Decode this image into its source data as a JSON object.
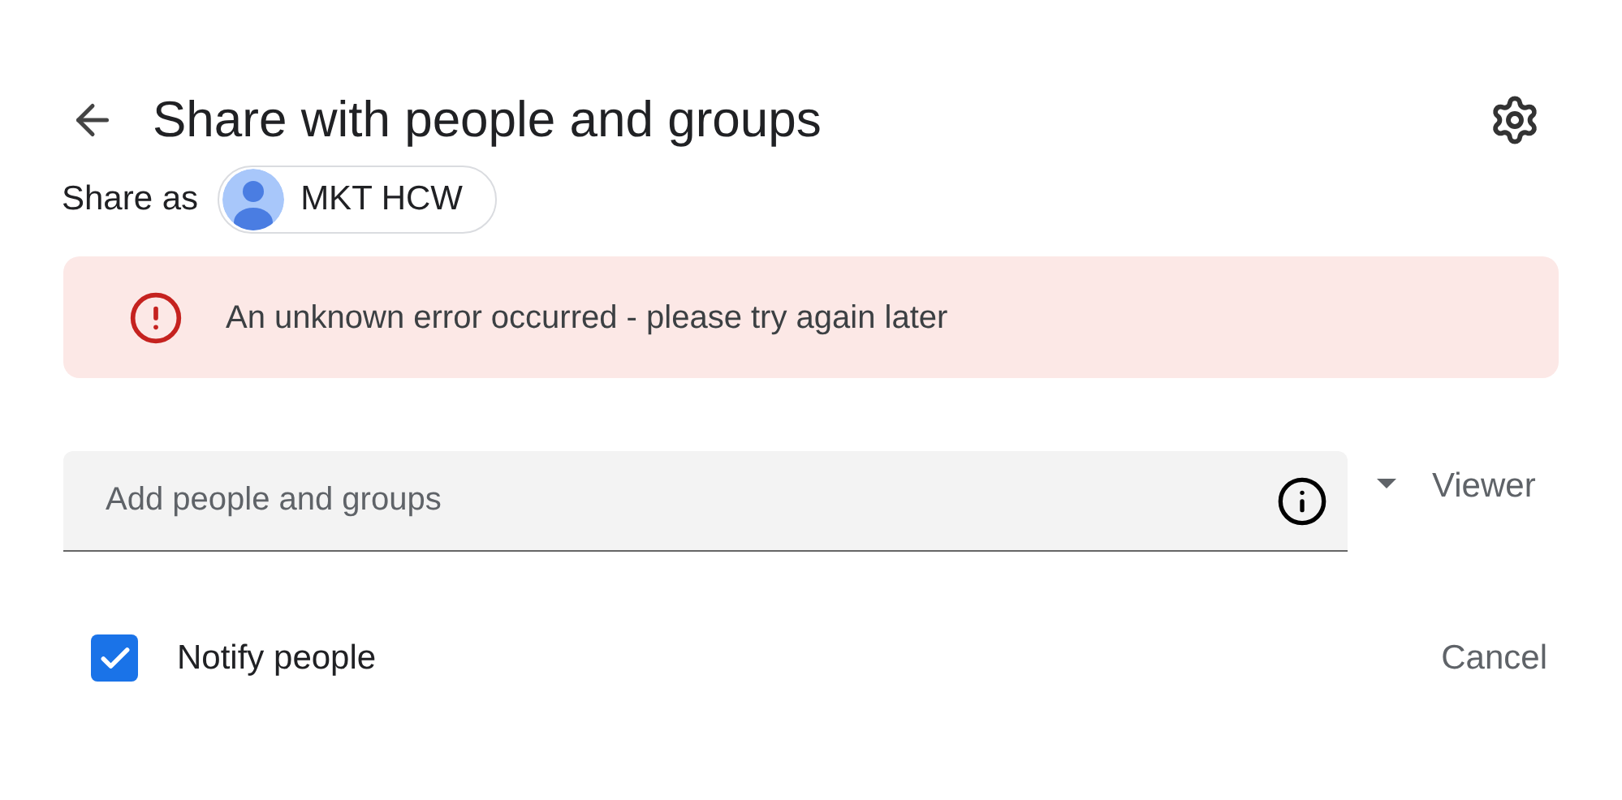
{
  "dialog": {
    "title": "Share with people and groups"
  },
  "share_as": {
    "label": "Share as",
    "account": "MKT HCW"
  },
  "error": {
    "message": "An unknown error occurred - please try again later"
  },
  "add_field": {
    "placeholder": "Add people and groups"
  },
  "role": {
    "value": "Viewer"
  },
  "notify": {
    "label": "Notify people",
    "checked": true
  },
  "buttons": {
    "cancel": "Cancel"
  }
}
